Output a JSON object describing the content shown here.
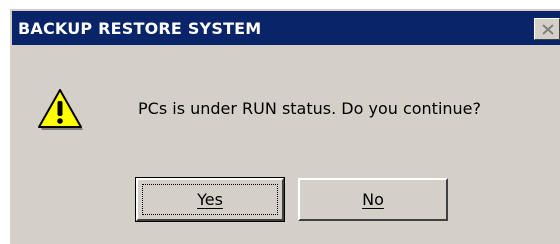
{
  "window": {
    "title": "BACKUP RESTORE SYSTEM",
    "close_icon": "close-icon",
    "colors": {
      "title_bar": "#0a246a",
      "title_text": "#ffffff",
      "dialog_bg": "#d4d0c8"
    }
  },
  "dialog": {
    "icon": "warning-icon",
    "message": "PCs is under RUN status. Do you continue?"
  },
  "buttons": {
    "yes": {
      "mnemonic": "Y",
      "rest": "es"
    },
    "no": {
      "mnemonic": "N",
      "rest": "o"
    },
    "default": "yes"
  }
}
